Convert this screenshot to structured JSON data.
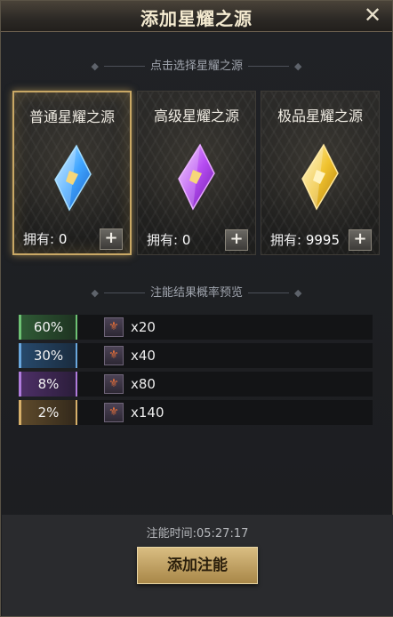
{
  "window": {
    "title": "添加星耀之源"
  },
  "select_section": {
    "title": "点击选择星耀之源"
  },
  "cards": [
    {
      "name": "普通星耀之源",
      "count_label": "拥有:",
      "count": "0",
      "gem_color": "#4fb4ff",
      "selected": true
    },
    {
      "name": "高级星耀之源",
      "count_label": "拥有:",
      "count": "0",
      "gem_color": "#b24cf0",
      "selected": false
    },
    {
      "name": "极品星耀之源",
      "count_label": "拥有:",
      "count": "9995",
      "gem_color": "#f1c232",
      "selected": false
    }
  ],
  "preview_section": {
    "title": "注能结果概率预览"
  },
  "results": [
    {
      "percent": "60%",
      "quantity": "x20",
      "tier_color": "green"
    },
    {
      "percent": "30%",
      "quantity": "x40",
      "tier_color": "blue"
    },
    {
      "percent": "8%",
      "quantity": "x80",
      "tier_color": "purple"
    },
    {
      "percent": "2%",
      "quantity": "x140",
      "tier_color": "gold"
    }
  ],
  "footer": {
    "timer": "注能时间:05:27:17",
    "action_label": "添加注能"
  },
  "icons": {
    "close": "close-icon",
    "plus": "plus-icon",
    "result_item": "fleur-item-icon"
  }
}
